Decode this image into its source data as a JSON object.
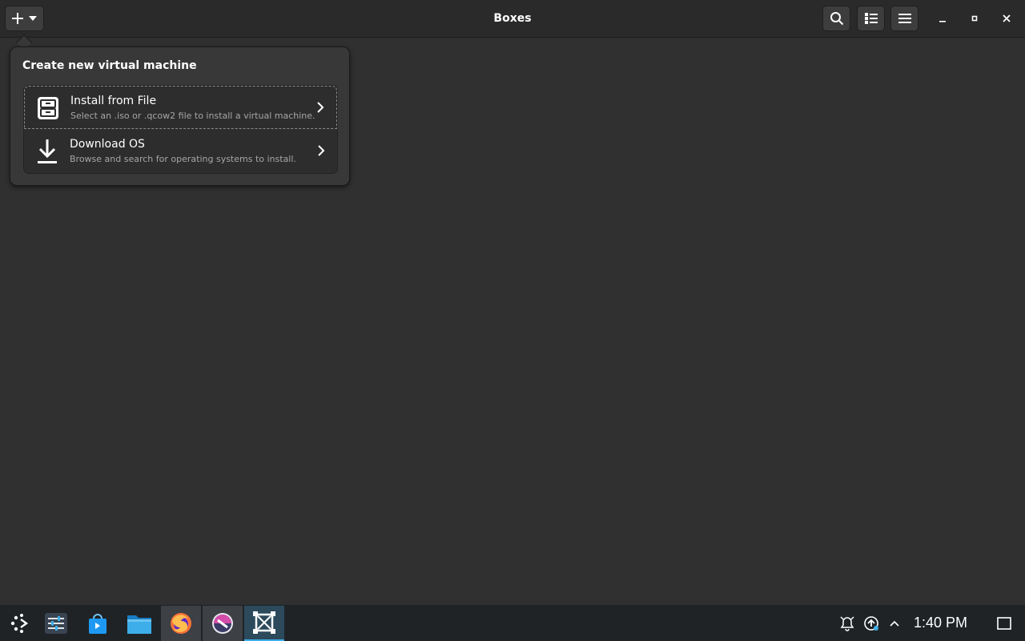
{
  "window": {
    "title": "Boxes"
  },
  "popover": {
    "title": "Create new virtual machine",
    "items": [
      {
        "label": "Install from File",
        "description": "Select an .iso or .qcow2 file to install a virtual machine.",
        "icon": "file-cabinet-icon"
      },
      {
        "label": "Download OS",
        "description": "Browse and search for operating systems to install.",
        "icon": "download-icon"
      }
    ]
  },
  "header_buttons": [
    "plus-icon",
    "search-icon",
    "list-view-icon",
    "hamburger-menu-icon",
    "minimize-icon",
    "maximize-icon",
    "close-icon"
  ],
  "taskbar": {
    "apps": [
      "application-launcher-icon",
      "system-settings-icon",
      "discover-store-icon",
      "file-manager-icon",
      "firefox-icon",
      "app-icon",
      "boxes-icon"
    ],
    "clock": "1:40 PM"
  },
  "colors": {
    "accent": "#3daee9",
    "background": "#303030",
    "headerbar": "#2a2a2a",
    "taskbar": "#1f2326"
  }
}
